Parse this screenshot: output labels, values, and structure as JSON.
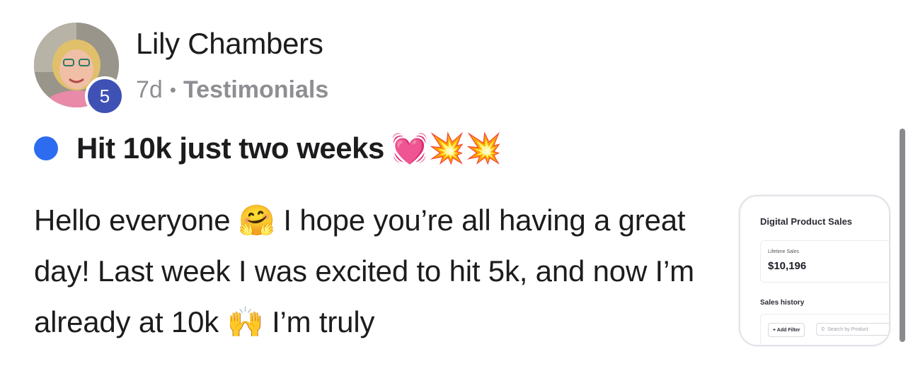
{
  "author": {
    "name": "Lily Chambers",
    "level": "5",
    "avatar_icon": "profile-photo"
  },
  "meta": {
    "time_ago": "7d",
    "separator": "•",
    "category": "Testimonials"
  },
  "post": {
    "title": "Hit 10k just two weeks",
    "title_emojis": "💓💥💥",
    "body": "Hello everyone 🤗 I hope you’re all having a great day! Last week I was excited to hit 5k, and now I’m already at 10k 🙌 I’m truly"
  },
  "thumbnail": {
    "title": "Digital Product Sales",
    "lifetime_label": "Lifetime Sales",
    "lifetime_value": "$10,196",
    "history_label": "Sales history",
    "add_filter_label": "+ Add Filter",
    "search_placeholder": "Search by Product"
  },
  "colors": {
    "unread_dot": "#2d6cf0",
    "level_badge": "#3f51b5",
    "meta_text": "#8e8e93"
  }
}
